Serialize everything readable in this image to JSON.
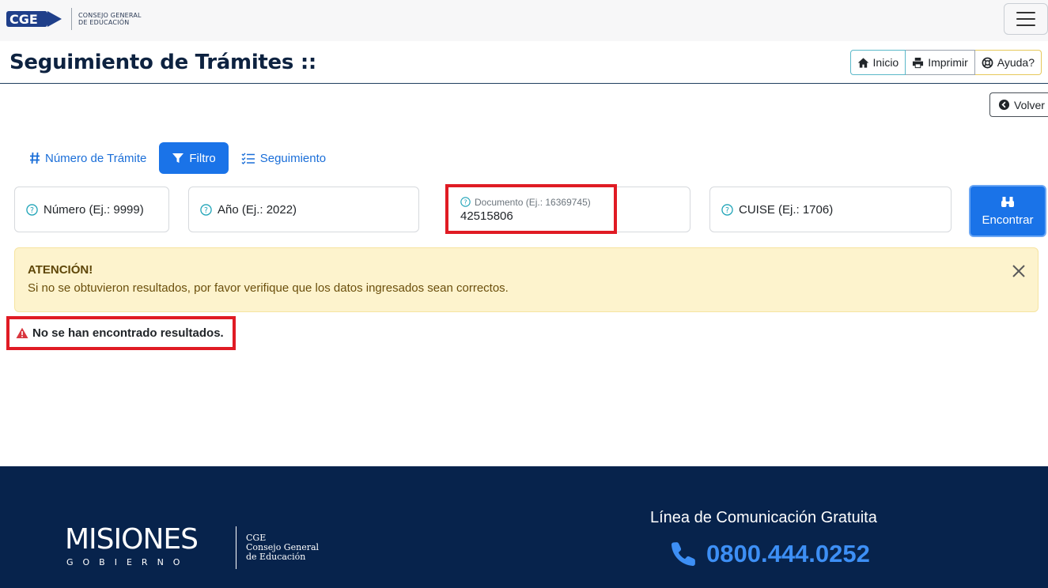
{
  "header": {
    "logo_text_line1": "CONSEJO GENERAL",
    "logo_text_line2": "DE EDUCACIÓN"
  },
  "page": {
    "title": "Seguimiento de Trámites ::",
    "actions": {
      "inicio": "Inicio",
      "imprimir": "Imprimir",
      "ayuda": "Ayuda?"
    },
    "volver": "Volver"
  },
  "tabs": [
    {
      "label": "Número de Trámite",
      "icon": "hash-icon"
    },
    {
      "label": "Filtro",
      "icon": "filter-icon",
      "active": true
    },
    {
      "label": "Seguimiento",
      "icon": "list-check-icon"
    }
  ],
  "fields": {
    "numero_placeholder": "Número (Ej.: 9999)",
    "anio_placeholder": "Año (Ej.: 2022)",
    "documento_label": "Documento (Ej.: 16369745)",
    "documento_value": "42515806",
    "cuise_placeholder": "CUISE (Ej.: 1706)"
  },
  "search_button": "Encontrar",
  "alert": {
    "title": "ATENCIÓN!",
    "text": "Si no se obtuvieron resultados, por favor verifique que los datos ingresados sean correctos."
  },
  "no_results": "No se han encontrado resultados.",
  "footer": {
    "misiones": "MISIONES",
    "gobierno": "GOBIERNO",
    "cge_line1": "CGE",
    "cge_line2": "Consejo General",
    "cge_line3": "de Educación",
    "linea_title": "Línea de Comunicación Gratuita",
    "phone": "0800.444.0252"
  },
  "colors": {
    "primary": "#1a73e8",
    "footer_bg": "#07234c",
    "alert_bg": "#fdf3cd",
    "highlight": "#e01b24"
  }
}
